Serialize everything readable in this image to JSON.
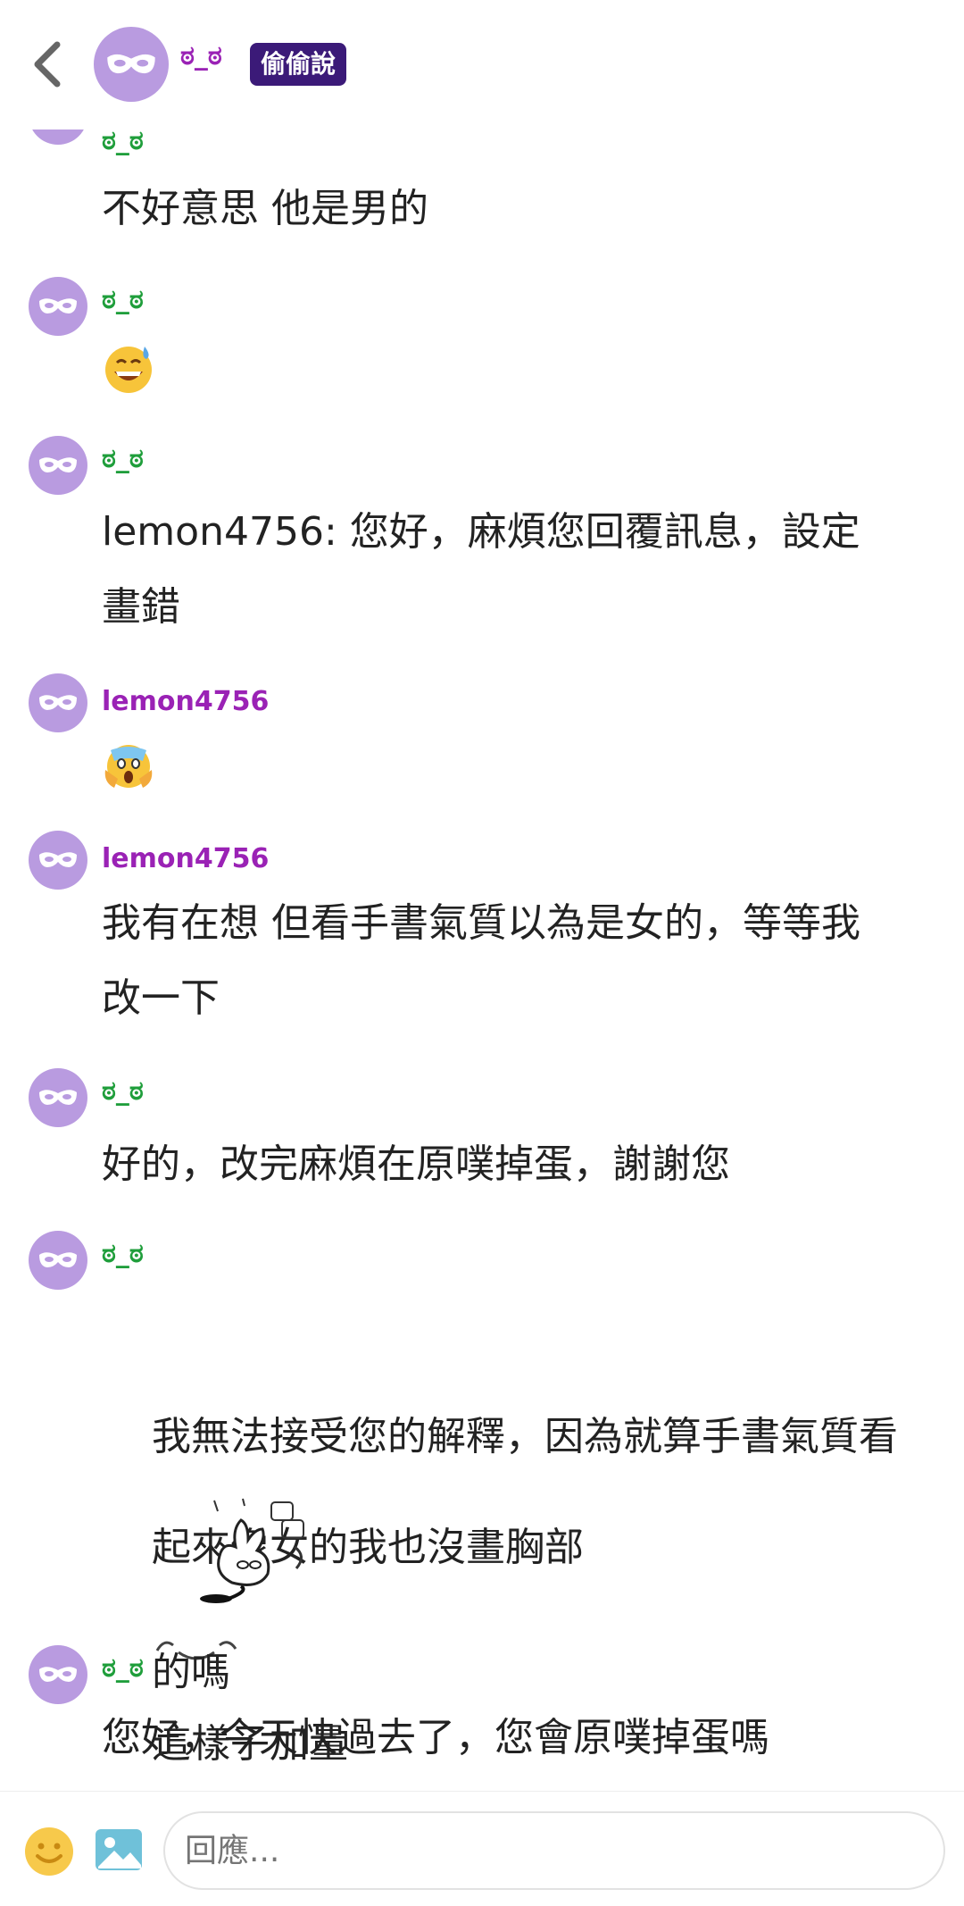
{
  "header": {
    "title": "ಠ_ಠ",
    "badge": "偷偷說"
  },
  "messages": [
    {
      "user": "ಠ_ಠ",
      "color": "#1f9e3b",
      "text": "不好意思 他是男的"
    },
    {
      "user": "ಠ_ಠ",
      "color": "#1f9e3b",
      "emoji": "grinning-sweat-emoji"
    },
    {
      "user": "ಠ_ಠ",
      "color": "#1f9e3b",
      "text": "lemon4756: 您好，麻煩您回覆訊息，設定\n畫錯"
    },
    {
      "user": "lemon4756",
      "color": "#9a22b5",
      "emoji": "screaming-face-emoji"
    },
    {
      "user": "lemon4756",
      "color": "#9a22b5",
      "text": "我有在想 但看手書氣質以為是女的，等等我\n改一下"
    },
    {
      "user": "ಠ_ಠ",
      "color": "#1f9e3b",
      "text": "好的，改完麻煩在原噗掉蛋，謝謝您"
    },
    {
      "user": "ಠ_ಠ",
      "color": "#1f9e3b",
      "line1": "我無法接受您的解釋，因為就算手書氣質看",
      "line2a": "起來像女的我也沒畫胸部",
      "line2b": "這樣子加量",
      "line3": "的嗎"
    },
    {
      "user": "ಠ_ಠ",
      "color": "#1f9e3b",
      "text": "您好，今天快過去了，您會原噗掉蛋嗎"
    }
  ],
  "composer": {
    "placeholder": "回應..."
  },
  "icons": [
    "back-chevron-icon",
    "mask-avatar-icon",
    "smiley-icon",
    "image-icon"
  ]
}
